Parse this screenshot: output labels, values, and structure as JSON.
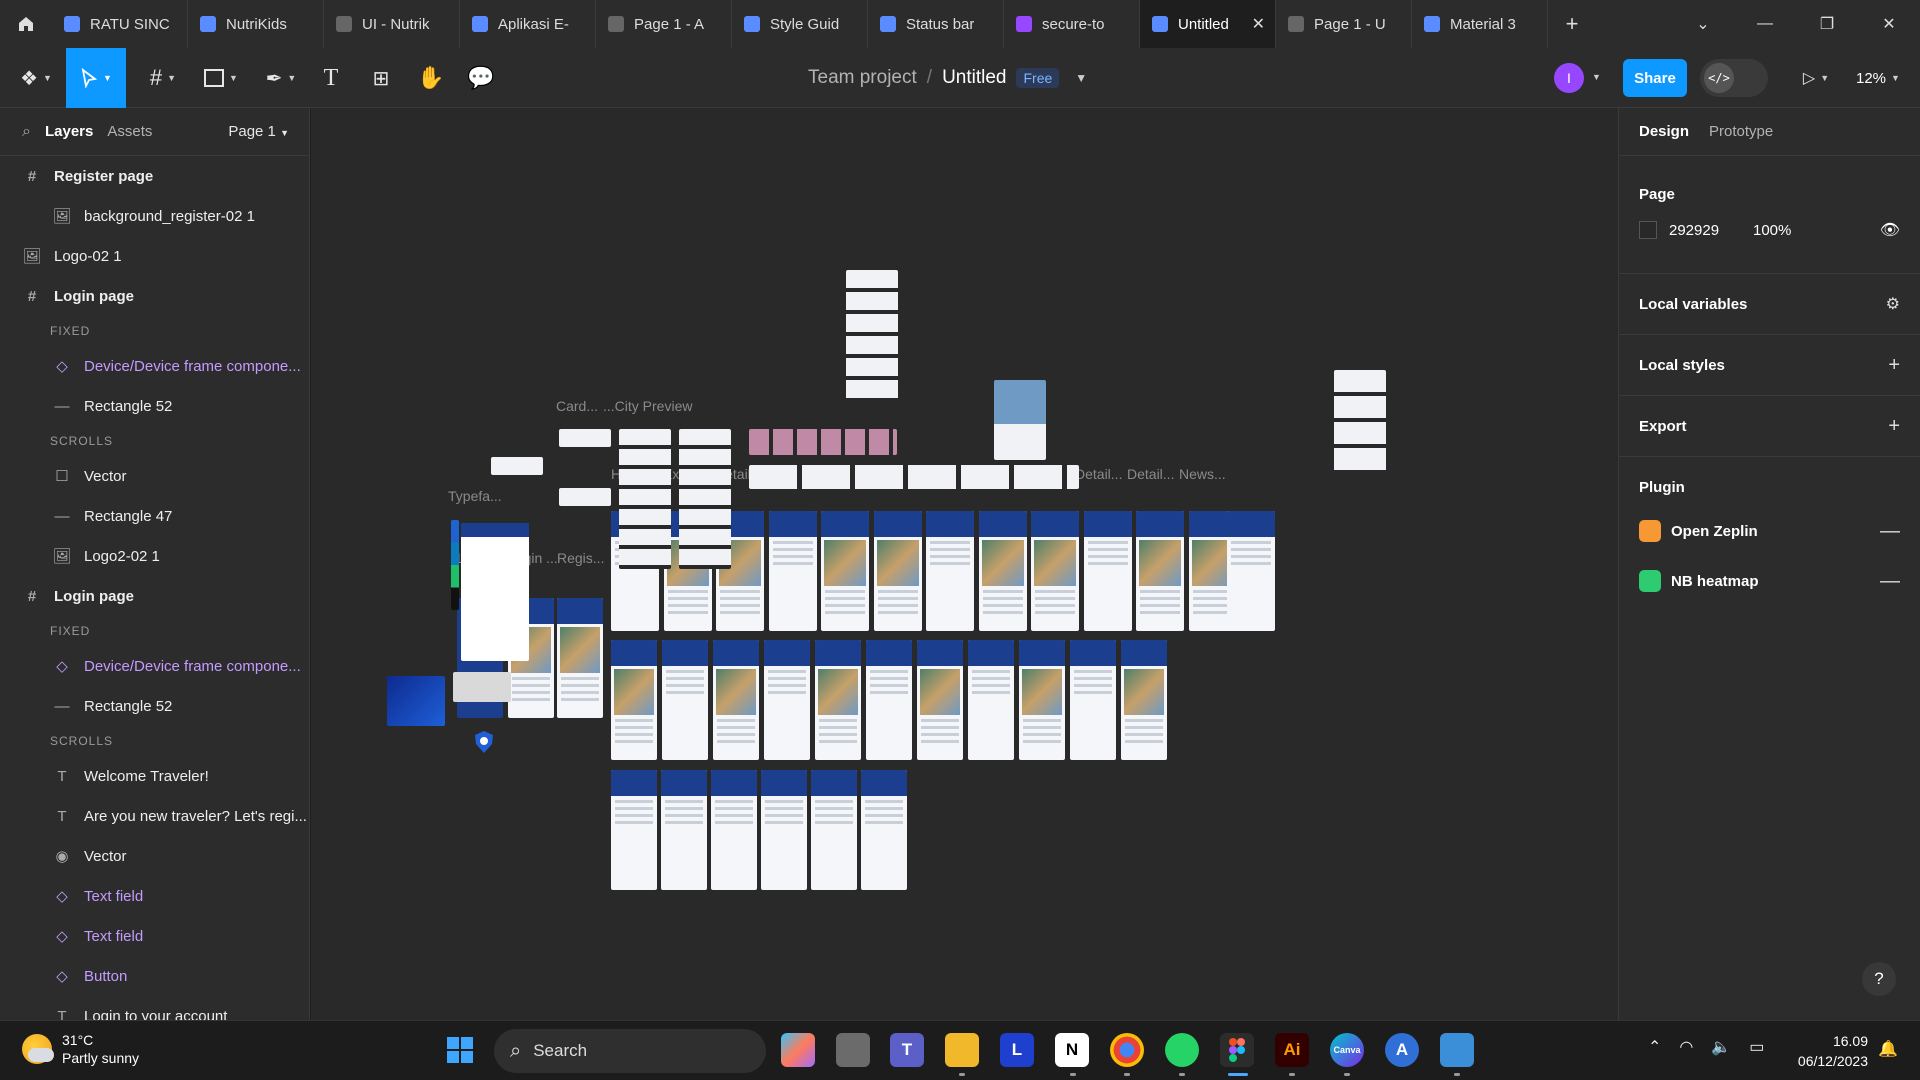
{
  "tabs": [
    {
      "label": "RATU SINC",
      "icon": "figma-file-icon",
      "color": "#5b8cff"
    },
    {
      "label": "NutriKids",
      "icon": "figma-file-icon",
      "color": "#5b8cff"
    },
    {
      "label": "UI - Nutrik",
      "icon": "prototype-play-icon",
      "color": "#666666"
    },
    {
      "label": "Aplikasi E-",
      "icon": "figma-file-icon",
      "color": "#5b8cff"
    },
    {
      "label": "Page 1 - A",
      "icon": "prototype-play-icon",
      "color": "#666666"
    },
    {
      "label": "Style Guid",
      "icon": "figma-file-icon",
      "color": "#5b8cff"
    },
    {
      "label": "Status bar",
      "icon": "figma-file-icon",
      "color": "#5b8cff"
    },
    {
      "label": "secure-to",
      "icon": "figjam-file-icon",
      "color": "#9747ff"
    },
    {
      "label": "Untitled",
      "icon": "figma-file-icon",
      "color": "#5b8cff",
      "active": true
    },
    {
      "label": "Page 1 - U",
      "icon": "prototype-play-icon",
      "color": "#666666"
    },
    {
      "label": "Material 3",
      "icon": "figma-file-icon",
      "color": "#5b8cff"
    }
  ],
  "header": {
    "project": "Team project",
    "separator": "/",
    "file": "Untitled",
    "plan_badge": "Free",
    "avatar_initial": "I",
    "share_label": "Share",
    "dev_mode_glyph": "</>",
    "zoom": "12%"
  },
  "left_panel": {
    "tab_layers": "Layers",
    "tab_assets": "Assets",
    "page_selector": "Page 1",
    "layers": [
      {
        "label": "Register page",
        "kind": "frame",
        "indent": 0
      },
      {
        "label": "background_register-02 1",
        "kind": "image",
        "indent": 1
      },
      {
        "label": "Logo-02 1",
        "kind": "image",
        "indent": 0
      },
      {
        "label": "Login page",
        "kind": "frame",
        "indent": 0
      },
      {
        "label": "FIXED",
        "kind": "section"
      },
      {
        "label": "Device/Device frame compone...",
        "kind": "component",
        "indent": 1
      },
      {
        "label": "Rectangle 52",
        "kind": "line",
        "indent": 1
      },
      {
        "label": "SCROLLS",
        "kind": "section"
      },
      {
        "label": "Vector",
        "kind": "vector",
        "indent": 1
      },
      {
        "label": "Rectangle 47",
        "kind": "line",
        "indent": 1
      },
      {
        "label": "Logo2-02 1",
        "kind": "image",
        "indent": 1
      },
      {
        "label": "Login page",
        "kind": "frame",
        "indent": 0
      },
      {
        "label": "FIXED",
        "kind": "section"
      },
      {
        "label": "Device/Device frame compone...",
        "kind": "component",
        "indent": 1
      },
      {
        "label": "Rectangle 52",
        "kind": "line",
        "indent": 1
      },
      {
        "label": "SCROLLS",
        "kind": "section"
      },
      {
        "label": "Welcome Traveler!",
        "kind": "text",
        "indent": 1
      },
      {
        "label": "Are you new traveler? Let's regi...",
        "kind": "text",
        "indent": 1
      },
      {
        "label": "Vector",
        "kind": "eye",
        "indent": 1
      },
      {
        "label": "Text field",
        "kind": "component",
        "indent": 1
      },
      {
        "label": "Text field",
        "kind": "component",
        "indent": 1
      },
      {
        "label": "Button",
        "kind": "component",
        "indent": 1
      },
      {
        "label": "Login to your account",
        "kind": "text",
        "indent": 1
      }
    ]
  },
  "canvas": {
    "labels": [
      "Typefa...",
      "Card...",
      "...City Preview",
      "Home",
      "Explo...",
      "Detail...",
      "Detail...",
      "Detail...",
      "Detail...",
      "Detail...",
      "Detail...",
      "News...",
      "Detail...",
      "Detail...",
      "News...",
      "Login ...",
      "Login ...",
      "Regis..."
    ]
  },
  "right_panel": {
    "tab_design": "Design",
    "tab_prototype": "Prototype",
    "page_title": "Page",
    "page_color": "292929",
    "page_opacity": "100%",
    "local_variables": "Local variables",
    "local_styles": "Local styles",
    "export": "Export",
    "plugin_title": "Plugin",
    "plugins": [
      {
        "label": "Open Zeplin",
        "icon": "zeplin-icon",
        "color": "#f69833"
      },
      {
        "label": "NB heatmap",
        "icon": "heatmap-icon",
        "color": "#2ecc71"
      }
    ],
    "help": "?"
  },
  "taskbar": {
    "temperature": "31°C",
    "weather": "Partly sunny",
    "search_placeholder": "Search",
    "time": "16.09",
    "date": "06/12/2023"
  }
}
